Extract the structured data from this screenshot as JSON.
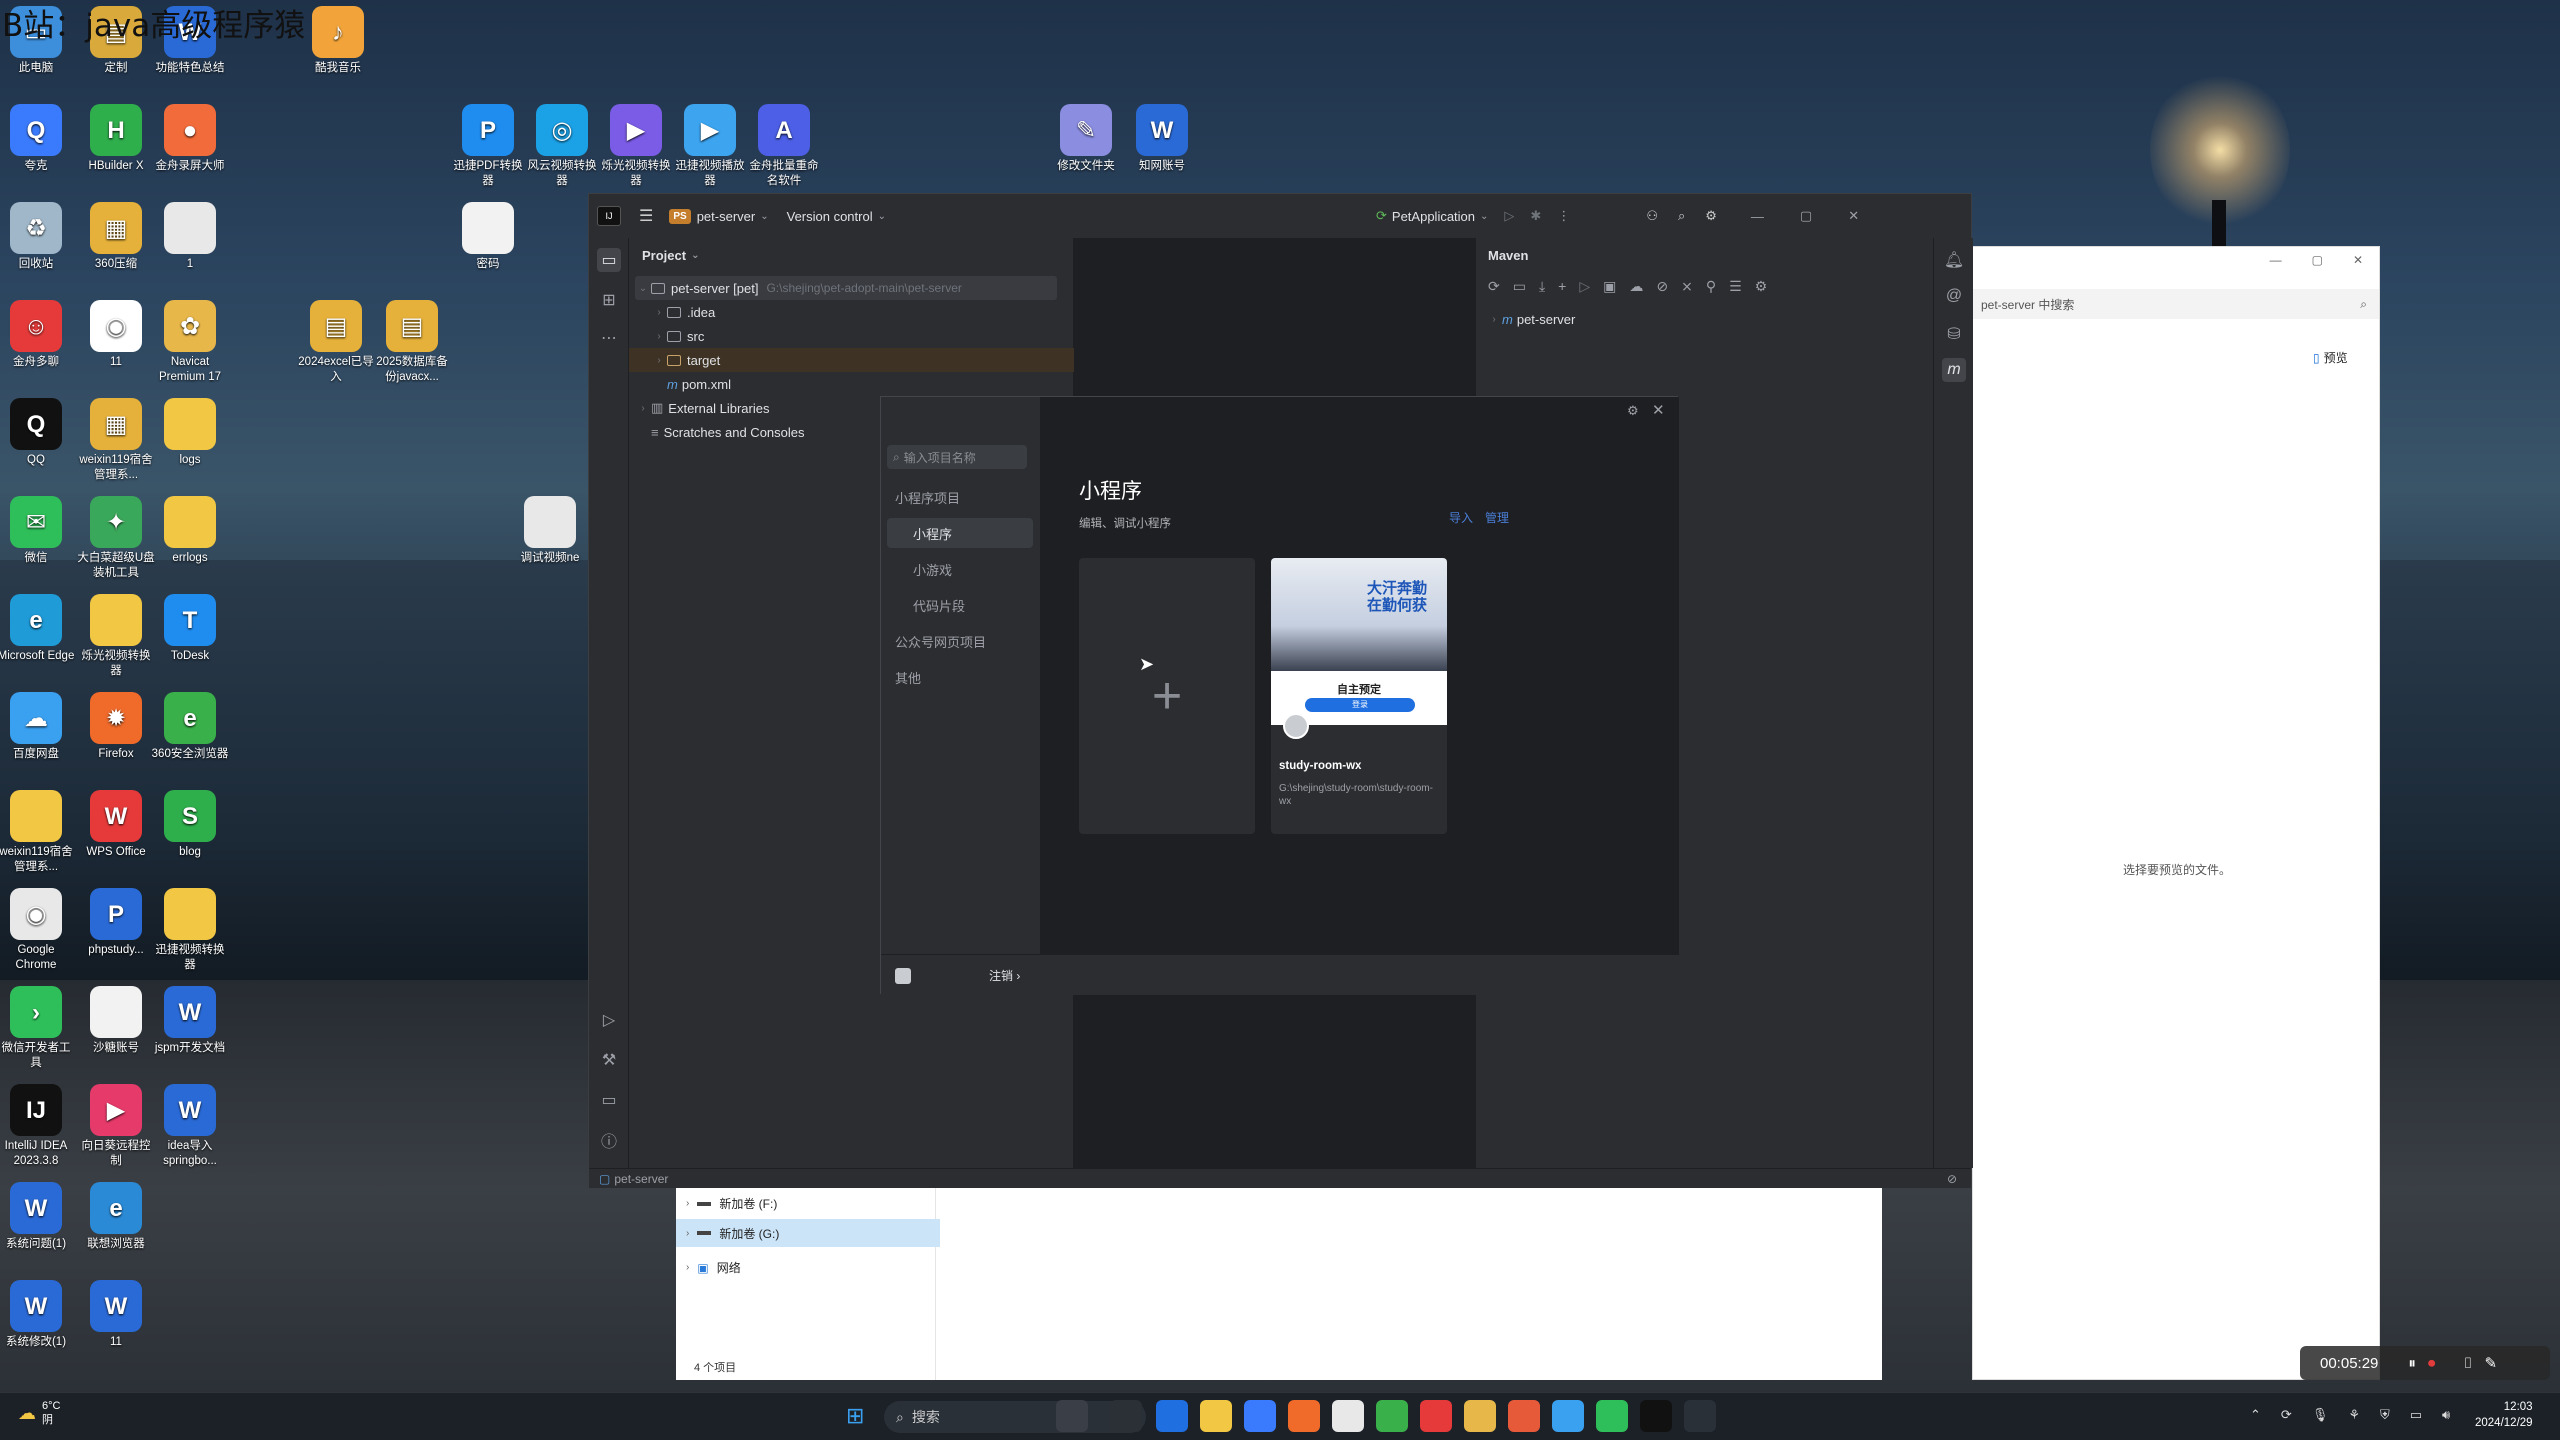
{
  "watermark": "B站：java高级程序猿",
  "desktop_icons": [
    {
      "label": "此电脑",
      "color": "#3d8fdc",
      "glyph": "▭"
    },
    {
      "label": "定制",
      "color": "#d9a93b",
      "glyph": "▤"
    },
    {
      "label": "功能特色总结",
      "color": "#2a6ad6",
      "glyph": "W"
    },
    {
      "label": "酷我音乐",
      "color": "#f2a43a",
      "glyph": "♪"
    },
    {
      "label": "夸克",
      "color": "#3a7bfd",
      "glyph": "Q"
    },
    {
      "label": "HBuilder X",
      "color": "#2fae4c",
      "glyph": "H"
    },
    {
      "label": "金舟录屏大师",
      "color": "#f26b3a",
      "glyph": "●"
    },
    {
      "label": "迅捷PDF转换器",
      "color": "#1f8df0",
      "glyph": "P"
    },
    {
      "label": "风云视频转换器",
      "color": "#1aa1e6",
      "glyph": "◎"
    },
    {
      "label": "烁光视频转换器",
      "color": "#7b5ce6",
      "glyph": "▶"
    },
    {
      "label": "迅捷视频播放器",
      "color": "#3da4f0",
      "glyph": "▶"
    },
    {
      "label": "金舟批量重命名软件",
      "color": "#4c5fe6",
      "glyph": "A"
    },
    {
      "label": "修改文件夹",
      "color": "#8a8de0",
      "glyph": "✎"
    },
    {
      "label": "知网账号",
      "color": "#2a6ad6",
      "glyph": "W"
    },
    {
      "label": "回收站",
      "color": "#9fb7c8",
      "glyph": "♻"
    },
    {
      "label": "360压缩",
      "color": "#e6b13a",
      "glyph": "▦"
    },
    {
      "label": "1",
      "color": "#e8e8e8",
      "glyph": " "
    },
    {
      "label": "密码",
      "color": "#f2f2f2",
      "glyph": " "
    },
    {
      "label": "金舟多聊",
      "color": "#e63a3a",
      "glyph": "☺"
    },
    {
      "label": "11",
      "color": "#ffffff",
      "glyph": "◉"
    },
    {
      "label": "Navicat Premium 17",
      "color": "#e8b74a",
      "glyph": "✿"
    },
    {
      "label": "2024excel已导入",
      "color": "#e6b13a",
      "glyph": "▤"
    },
    {
      "label": "2025数据库备份javacx...",
      "color": "#e6b13a",
      "glyph": "▤"
    },
    {
      "label": "QQ",
      "color": "#111111",
      "glyph": "Q"
    },
    {
      "label": "weixin119宿舍管理系...",
      "color": "#e6b13a",
      "glyph": "▦"
    },
    {
      "label": "logs",
      "color": "#f2c744",
      "glyph": " "
    },
    {
      "label": "微信",
      "color": "#2fbf5a",
      "glyph": "✉"
    },
    {
      "label": "大白菜超级U盘装机工具",
      "color": "#3aa85a",
      "glyph": "✦"
    },
    {
      "label": "errlogs",
      "color": "#f2c744",
      "glyph": " "
    },
    {
      "label": "调试视频ne",
      "color": "#e8e8e8",
      "glyph": " "
    },
    {
      "label": "Microsoft Edge",
      "color": "#1f9bd8",
      "glyph": "e"
    },
    {
      "label": "烁光视频转换器",
      "color": "#f2c744",
      "glyph": " "
    },
    {
      "label": "ToDesk",
      "color": "#1f8df0",
      "glyph": "T"
    },
    {
      "label": "百度网盘",
      "color": "#3aa0f0",
      "glyph": "☁"
    },
    {
      "label": "Firefox",
      "color": "#f06a2a",
      "glyph": "✹"
    },
    {
      "label": "360安全浏览器",
      "color": "#3ab04a",
      "glyph": "e"
    },
    {
      "label": "weixin119宿舍管理系...",
      "color": "#f2c744",
      "glyph": " "
    },
    {
      "label": "WPS Office",
      "color": "#e63a3a",
      "glyph": "W"
    },
    {
      "label": "blog",
      "color": "#2fae4c",
      "glyph": "S"
    },
    {
      "label": "Google Chrome",
      "color": "#e8e8e8",
      "glyph": "◉"
    },
    {
      "label": "phpstudy...",
      "color": "#2a6ad6",
      "glyph": "P"
    },
    {
      "label": "迅捷视频转换器",
      "color": "#f2c744",
      "glyph": " "
    },
    {
      "label": "微信开发者工具",
      "color": "#2fbf5a",
      "glyph": "›"
    },
    {
      "label": "沙糖账号",
      "color": "#f2f2f2",
      "glyph": " "
    },
    {
      "label": "jspm开发文档",
      "color": "#2a6ad6",
      "glyph": "W"
    },
    {
      "label": "IntelliJ IDEA 2023.3.8",
      "color": "#111111",
      "glyph": "IJ"
    },
    {
      "label": "向日葵远程控制",
      "color": "#e63a6a",
      "glyph": "▶"
    },
    {
      "label": "idea导入springbo...",
      "color": "#2a6ad6",
      "glyph": "W"
    },
    {
      "label": "系统问题(1)",
      "color": "#2a6ad6",
      "glyph": "W"
    },
    {
      "label": "联想浏览器",
      "color": "#2a8ad6",
      "glyph": "e"
    },
    {
      "label": "系统修改(1)",
      "color": "#2a6ad6",
      "glyph": "W"
    },
    {
      "label": "11",
      "color": "#2a6ad6",
      "glyph": "W"
    }
  ],
  "ide": {
    "project_badge": "PS",
    "project_name": "pet-server",
    "vcs": "Version control",
    "run_config": "PetApplication",
    "project_panel_title": "Project",
    "tree": [
      {
        "label": "pet-server [pet]",
        "path": "G:\\shejing\\pet-adopt-main\\pet-server"
      },
      {
        "label": ".idea"
      },
      {
        "label": "src"
      },
      {
        "label": "target"
      },
      {
        "label": "pom.xml"
      },
      {
        "label": "External Libraries"
      },
      {
        "label": "Scratches and Consoles"
      }
    ],
    "maven_title": "Maven",
    "maven_root": "pet-server",
    "status_project": "pet-server"
  },
  "dialog": {
    "search_placeholder": "输入项目名称",
    "section_mini": "小程序项目",
    "items": [
      "小程序",
      "小游戏",
      "代码片段"
    ],
    "section_public": "公众号网页项目",
    "section_other": "其他",
    "heading": "小程序",
    "subheading": "编辑、调试小程序",
    "action_import": "导入",
    "action_manage": "管理",
    "card_title": "study-room-wx",
    "card_path": "G:\\shejing\\study-room\\study-room-wx",
    "card_preview_text": "自主预定",
    "card_preview_btn": "登录",
    "card_banner": "大汗奔勤 在勤何获",
    "logout": "注销 ›"
  },
  "explorer": {
    "drives": [
      "新加卷 (F:)",
      "新加卷 (G:)"
    ],
    "network": "网络",
    "item_count": "4 个项目"
  },
  "right_window": {
    "search_placeholder": "pet-server 中搜索",
    "preview_btn": "预览",
    "preview_hint": "选择要预览的文件。"
  },
  "taskbar": {
    "weather_temp": "6°C",
    "weather_desc": "阴",
    "search": "搜索",
    "time": "12:03",
    "date": "2024/12/29"
  },
  "recorder": {
    "timer": "00:05:29"
  }
}
